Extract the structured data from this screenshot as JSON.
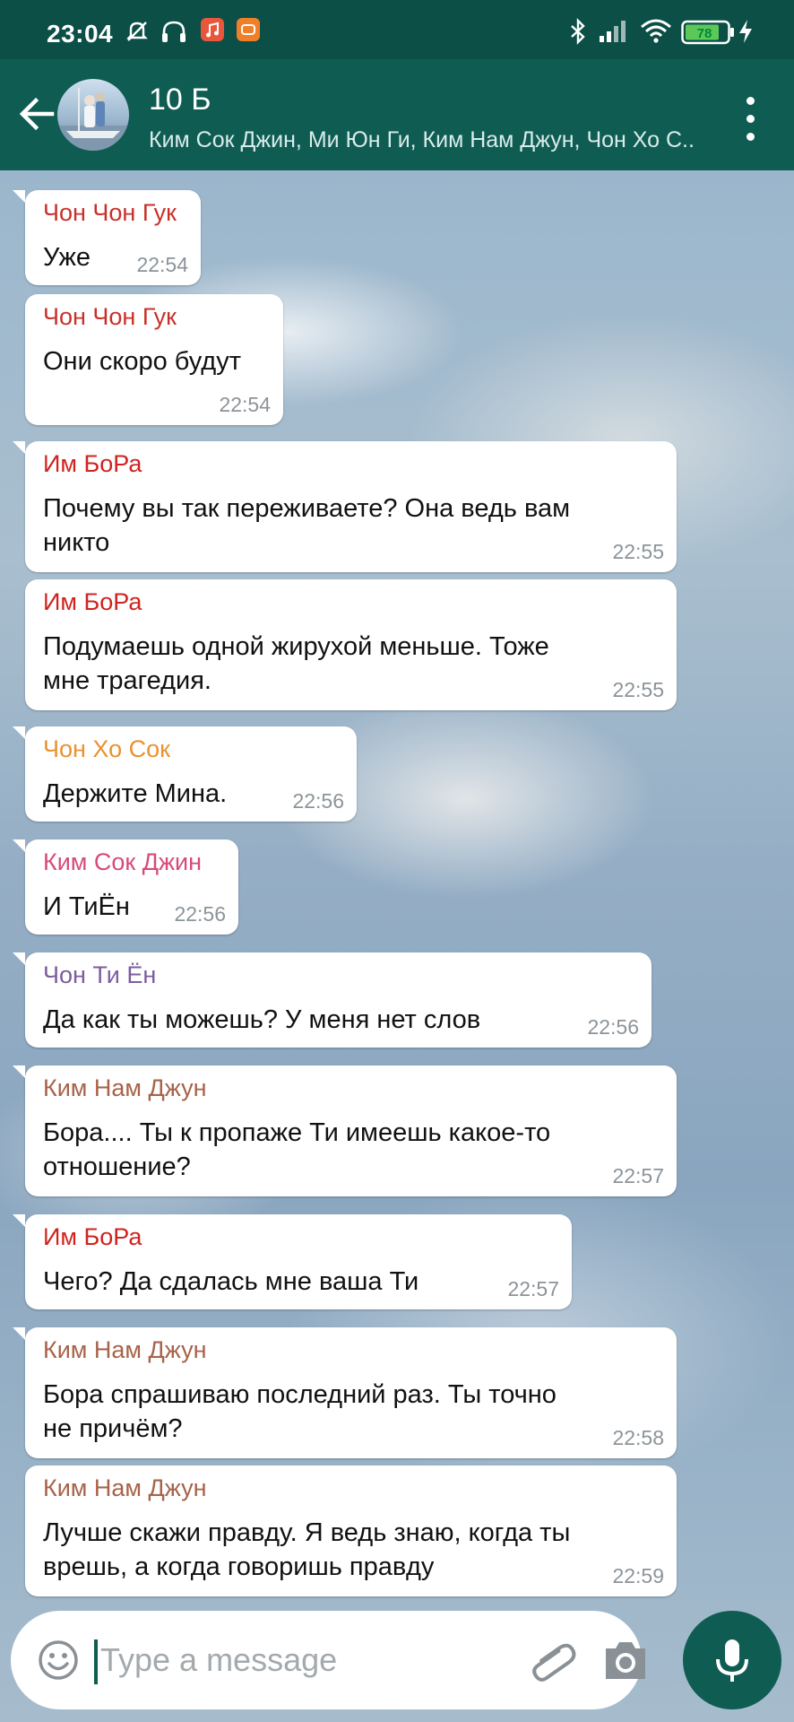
{
  "status_bar": {
    "time": "23:04",
    "battery": "78"
  },
  "header": {
    "title": "10 Б",
    "subtitle": "Ким Сок Джин, Ми Юн Ги, Ким Нам Джун, Чон Хо С.."
  },
  "messages": [
    {
      "sender": "Чон Чон Гук",
      "sender_color": "#c8312a",
      "lines": [
        "Уже"
      ],
      "time": "22:54"
    },
    {
      "sender": "Чон Чон Гук",
      "sender_color": "#c8312a",
      "lines": [
        "Они скоро будут"
      ],
      "time": "22:54"
    },
    {
      "sender": "Им БоРа",
      "sender_color": "#d0231f",
      "lines": [
        "Почему вы так переживаете? Она ведь вам",
        "никто"
      ],
      "time": "22:55"
    },
    {
      "sender": "Им БоРа",
      "sender_color": "#d0231f",
      "lines": [
        "Подумаешь одной жирухой меньше. Тоже",
        "мне трагедия."
      ],
      "time": "22:55"
    },
    {
      "sender": "Чон Хо Сок",
      "sender_color": "#e9922f",
      "lines": [
        "Держите Мина."
      ],
      "time": "22:56"
    },
    {
      "sender": "Ким Сок Джин",
      "sender_color": "#d64b7b",
      "lines": [
        "И ТиЁн"
      ],
      "time": "22:56"
    },
    {
      "sender": "Чон Ти Ён",
      "sender_color": "#7d5c9e",
      "lines": [
        "Да как ты можешь? У меня нет слов"
      ],
      "time": "22:56"
    },
    {
      "sender": "Ким Нам Джун",
      "sender_color": "#a8624a",
      "lines": [
        "Бора.... Ты к пропаже Ти имеешь какое-то",
        "отношение?"
      ],
      "time": "22:57"
    },
    {
      "sender": "Им БоРа",
      "sender_color": "#d0231f",
      "lines": [
        "Чего? Да сдалась мне ваша Ти"
      ],
      "time": "22:57"
    },
    {
      "sender": "Ким Нам Джун",
      "sender_color": "#a8624a",
      "lines": [
        "Бора спрашиваю последний раз. Ты точно",
        "не причём?"
      ],
      "time": "22:58"
    },
    {
      "sender": "Ким Нам Джун",
      "sender_color": "#a8624a",
      "lines": [
        "Лучше скажи правду. Я ведь знаю, когда ты",
        "врешь, а когда говоришь правду"
      ],
      "time": "22:59"
    }
  ],
  "composer": {
    "placeholder": "Type a message"
  },
  "icons": [
    "back-arrow-icon",
    "more-vert-icon",
    "emoji-icon",
    "attach-icon",
    "camera-icon",
    "mic-icon"
  ],
  "colors": {
    "header": "#0f5c53",
    "statusbar": "#0b4f46",
    "accent": "#0f5c53"
  }
}
